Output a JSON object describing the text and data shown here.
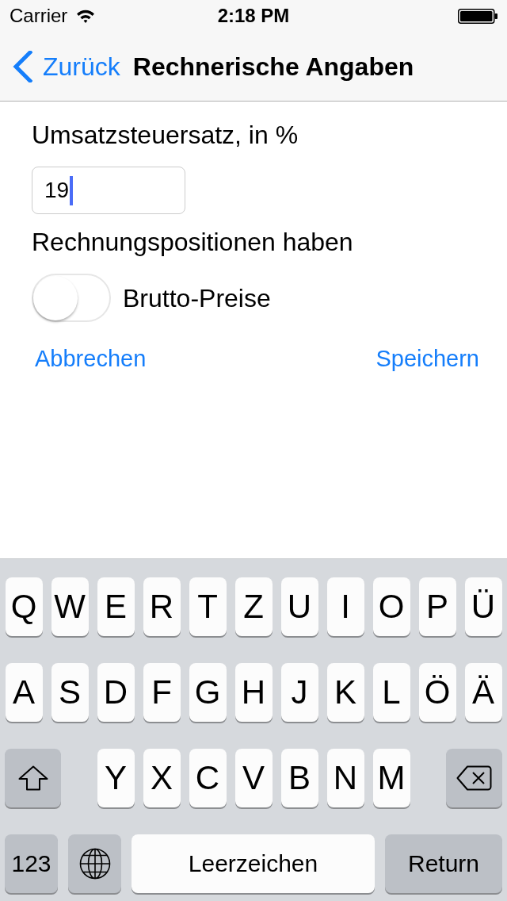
{
  "status_bar": {
    "carrier": "Carrier",
    "time": "2:18 PM"
  },
  "nav_bar": {
    "back_label": "Zurück",
    "title": "Rechnerische Angaben"
  },
  "form": {
    "tax_rate": {
      "label": "Umsatzsteuersatz, in %",
      "value": "19",
      "focused": true
    },
    "gross_prices": {
      "label": "Rechnungspositionen haben",
      "switch_label": "Brutto-Preise",
      "on": false
    }
  },
  "actions": {
    "cancel": "Abbrechen",
    "save": "Speichern"
  },
  "keyboard": {
    "letter_rows": [
      [
        "Q",
        "W",
        "E",
        "R",
        "T",
        "Z",
        "U",
        "I",
        "O",
        "P",
        "Ü"
      ],
      [
        "A",
        "S",
        "D",
        "F",
        "G",
        "H",
        "J",
        "K",
        "L",
        "Ö",
        "Ä"
      ]
    ],
    "third_row": {
      "letters": [
        "Y",
        "X",
        "C",
        "V",
        "B",
        "N",
        "M"
      ]
    },
    "bottom_row": [
      {
        "kind": "mode",
        "label": "123"
      },
      {
        "kind": "globe"
      },
      {
        "kind": "space",
        "label": "Leerzeichen"
      },
      {
        "kind": "return",
        "label": "Return"
      }
    ]
  }
}
